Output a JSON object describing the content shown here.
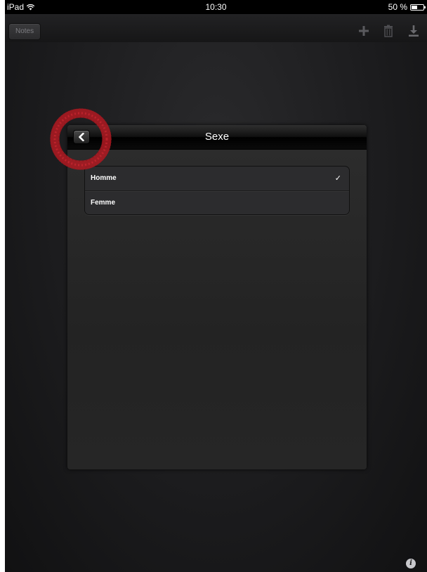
{
  "status_bar": {
    "device": "iPad",
    "time": "10:30",
    "battery": "50 %",
    "battery_level": 0.5
  },
  "toolbar": {
    "notes_label": "Notes",
    "icons": [
      "plus-icon",
      "trash-icon",
      "download-icon"
    ]
  },
  "popover": {
    "title": "Sexe",
    "options": [
      {
        "label": "Homme",
        "selected": true
      },
      {
        "label": "Femme",
        "selected": false
      }
    ],
    "check_mark": "✓"
  },
  "colors": {
    "background": "#1c1c1e",
    "highlight": "#b11a22",
    "text": "#ffffff"
  },
  "info_glyph": "i"
}
